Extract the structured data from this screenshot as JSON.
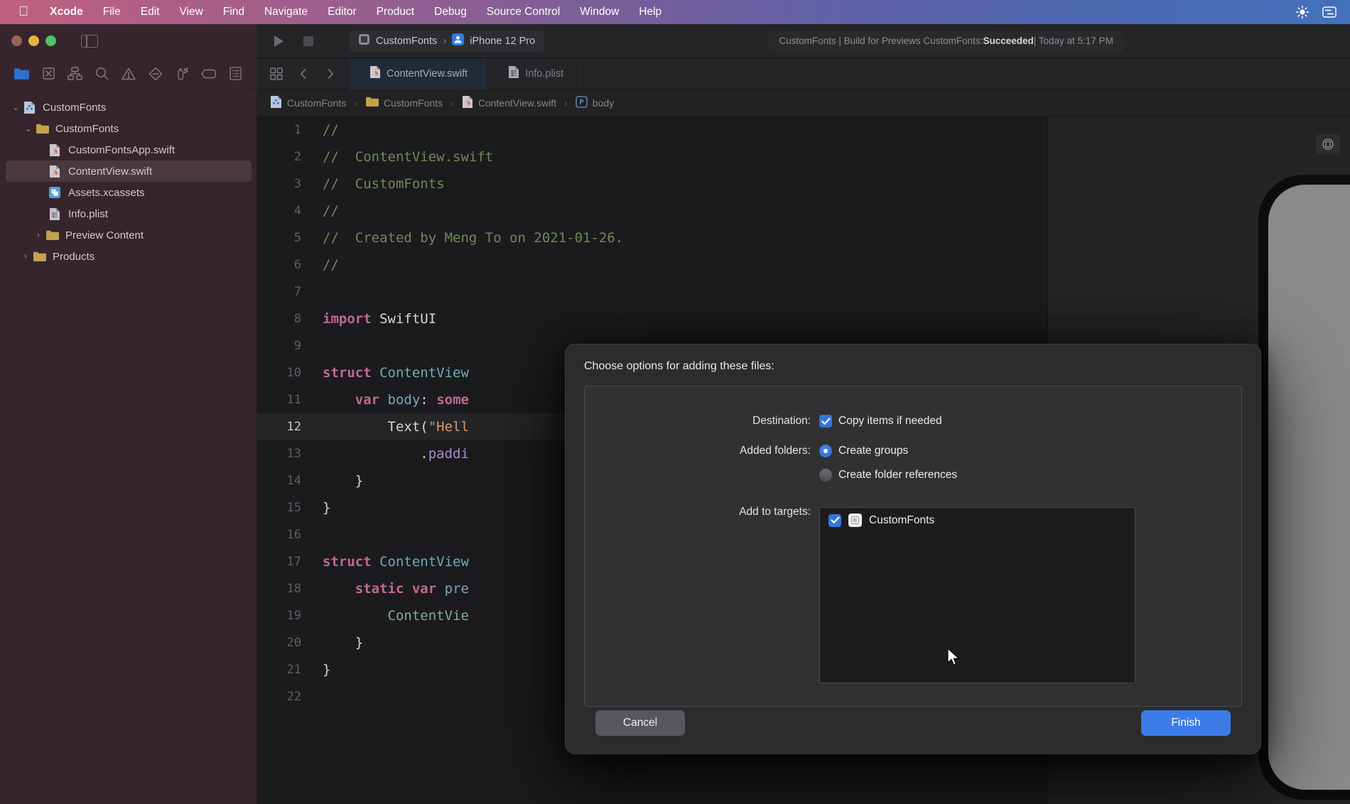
{
  "menubar": {
    "apple_icon": "apple-logo-icon",
    "items": [
      {
        "label": "Xcode",
        "bold": true
      },
      {
        "label": "File",
        "bold": false
      },
      {
        "label": "Edit",
        "bold": false
      },
      {
        "label": "View",
        "bold": false
      },
      {
        "label": "Find",
        "bold": false
      },
      {
        "label": "Navigate",
        "bold": false
      },
      {
        "label": "Editor",
        "bold": false
      },
      {
        "label": "Product",
        "bold": false
      },
      {
        "label": "Debug",
        "bold": false
      },
      {
        "label": "Source Control",
        "bold": false
      },
      {
        "label": "Window",
        "bold": false
      },
      {
        "label": "Help",
        "bold": false
      }
    ],
    "status_icons": [
      "brightness-icon",
      "control-center-icon"
    ]
  },
  "titlebar": {
    "traffic_lights": [
      "close-button",
      "minimize-button",
      "zoom-button"
    ],
    "sidebar_toggle_icon": "sidebar-toggle-icon",
    "run_icon": "run-icon",
    "stop_icon": "stop-icon",
    "scheme": {
      "project": "CustomFonts",
      "separator": "›",
      "device": "iPhone 12 Pro"
    },
    "status": {
      "prefix": "CustomFonts | Build for Previews CustomFonts: ",
      "result": "Succeeded",
      "suffix": " | Today at 5:17 PM"
    }
  },
  "navigator_toolbar": {
    "icons": [
      "project-navigator-icon",
      "source-control-navigator-icon",
      "symbol-navigator-icon",
      "find-navigator-icon",
      "issue-navigator-icon",
      "test-navigator-icon",
      "debug-navigator-icon",
      "breakpoint-navigator-icon",
      "report-navigator-icon"
    ]
  },
  "editor_tabs": {
    "grid_icon": "tab-grid-icon",
    "back_icon": "chevron-left-icon",
    "forward_icon": "chevron-right-icon",
    "tabs": [
      {
        "label": "ContentView.swift",
        "icon": "swift-file-icon",
        "active": true
      },
      {
        "label": "Info.plist",
        "icon": "plist-file-icon",
        "active": false
      }
    ]
  },
  "breadcrumb": {
    "separator": "›",
    "items": [
      {
        "label": "CustomFonts",
        "icon": "xcode-project-icon"
      },
      {
        "label": "CustomFonts",
        "icon": "folder-icon"
      },
      {
        "label": "ContentView.swift",
        "icon": "swift-file-icon"
      },
      {
        "label": "body",
        "icon": "property-icon"
      }
    ]
  },
  "navigator": {
    "items": [
      {
        "label": "CustomFonts",
        "icon": "xcode-project-icon",
        "indent": 0,
        "twisty": "⌄",
        "selected": false
      },
      {
        "label": "CustomFonts",
        "icon": "folder-icon",
        "indent": 1,
        "twisty": "⌄",
        "selected": false
      },
      {
        "label": "CustomFontsApp.swift",
        "icon": "swift-file-icon",
        "indent": 2,
        "twisty": "",
        "selected": false
      },
      {
        "label": "ContentView.swift",
        "icon": "swift-file-icon",
        "indent": 2,
        "twisty": "",
        "selected": true
      },
      {
        "label": "Assets.xcassets",
        "icon": "assets-icon",
        "indent": 2,
        "twisty": "",
        "selected": false
      },
      {
        "label": "Info.plist",
        "icon": "plist-file-icon",
        "indent": 2,
        "twisty": "",
        "selected": false
      },
      {
        "label": "Preview Content",
        "icon": "folder-icon",
        "indent": 2,
        "twisty": "›",
        "selected": false
      },
      {
        "label": "Products",
        "icon": "folder-icon",
        "indent": 1,
        "twisty": "›",
        "selected": false
      }
    ]
  },
  "editor": {
    "lines": [
      {
        "n": "1",
        "hl": false,
        "tokens": [
          {
            "t": "//",
            "c": "cmt"
          }
        ]
      },
      {
        "n": "2",
        "hl": false,
        "tokens": [
          {
            "t": "//  ContentView.swift",
            "c": "cmt"
          }
        ]
      },
      {
        "n": "3",
        "hl": false,
        "tokens": [
          {
            "t": "//  CustomFonts",
            "c": "cmt"
          }
        ]
      },
      {
        "n": "4",
        "hl": false,
        "tokens": [
          {
            "t": "//",
            "c": "cmt"
          }
        ]
      },
      {
        "n": "5",
        "hl": false,
        "tokens": [
          {
            "t": "//  Created by Meng To on 2021-01-26.",
            "c": "cmt"
          }
        ]
      },
      {
        "n": "6",
        "hl": false,
        "tokens": [
          {
            "t": "//",
            "c": "cmt"
          }
        ]
      },
      {
        "n": "7",
        "hl": false,
        "tokens": [
          {
            "t": "",
            "c": "pln"
          }
        ]
      },
      {
        "n": "8",
        "hl": false,
        "tokens": [
          {
            "t": "import",
            "c": "kw"
          },
          {
            "t": " SwiftUI",
            "c": "pln"
          }
        ]
      },
      {
        "n": "9",
        "hl": false,
        "tokens": [
          {
            "t": "",
            "c": "pln"
          }
        ]
      },
      {
        "n": "10",
        "hl": false,
        "tokens": [
          {
            "t": "struct",
            "c": "kw"
          },
          {
            "t": " ContentView",
            "c": "typ"
          }
        ]
      },
      {
        "n": "11",
        "hl": false,
        "tokens": [
          {
            "t": "    ",
            "c": "pln"
          },
          {
            "t": "var",
            "c": "kw"
          },
          {
            "t": " body",
            "c": "typ"
          },
          {
            "t": ": ",
            "c": "pln"
          },
          {
            "t": "some",
            "c": "kw"
          }
        ]
      },
      {
        "n": "12",
        "hl": true,
        "tokens": [
          {
            "t": "        Text(",
            "c": "pln"
          },
          {
            "t": "\"Hell",
            "c": "str"
          }
        ]
      },
      {
        "n": "13",
        "hl": false,
        "tokens": [
          {
            "t": "            .",
            "c": "pln"
          },
          {
            "t": "paddi",
            "c": "fn"
          }
        ]
      },
      {
        "n": "14",
        "hl": false,
        "tokens": [
          {
            "t": "    }",
            "c": "pln"
          }
        ]
      },
      {
        "n": "15",
        "hl": false,
        "tokens": [
          {
            "t": "}",
            "c": "pln"
          }
        ]
      },
      {
        "n": "16",
        "hl": false,
        "tokens": [
          {
            "t": "",
            "c": "pln"
          }
        ]
      },
      {
        "n": "17",
        "hl": false,
        "tokens": [
          {
            "t": "struct",
            "c": "kw"
          },
          {
            "t": " ContentView",
            "c": "typ"
          }
        ]
      },
      {
        "n": "18",
        "hl": false,
        "tokens": [
          {
            "t": "    ",
            "c": "pln"
          },
          {
            "t": "static",
            "c": "kw"
          },
          {
            "t": " ",
            "c": "pln"
          },
          {
            "t": "var",
            "c": "kw"
          },
          {
            "t": " pre",
            "c": "typ"
          }
        ]
      },
      {
        "n": "19",
        "hl": false,
        "tokens": [
          {
            "t": "        ContentVie",
            "c": "grn"
          }
        ]
      },
      {
        "n": "20",
        "hl": false,
        "tokens": [
          {
            "t": "    }",
            "c": "pln"
          }
        ]
      },
      {
        "n": "21",
        "hl": false,
        "tokens": [
          {
            "t": "}",
            "c": "pln"
          }
        ]
      },
      {
        "n": "22",
        "hl": false,
        "tokens": [
          {
            "t": "",
            "c": "pln"
          }
        ]
      }
    ]
  },
  "canvas": {
    "control_icon": "preview-device-settings-icon",
    "device": "iPhone 12 Pro"
  },
  "dialog": {
    "title": "Choose options for adding these files:",
    "destination": {
      "label": "Destination:",
      "checkbox_label": "Copy items if needed",
      "checked": true
    },
    "added_folders": {
      "label": "Added folders:",
      "options": [
        {
          "label": "Create groups",
          "selected": true
        },
        {
          "label": "Create folder references",
          "selected": false
        }
      ]
    },
    "add_to_targets": {
      "label": "Add to targets:",
      "rows": [
        {
          "name": "CustomFonts",
          "checked": true,
          "icon": "app-target-icon"
        }
      ]
    },
    "cancel_label": "Cancel",
    "finish_label": "Finish"
  },
  "colors": {
    "accent_blue": "#3574e0",
    "finish_blue": "#3c7ce8",
    "sidebar_bg": "#36252c",
    "editor_bg": "#1b1b1d",
    "dialog_bg": "#2c2c2e"
  }
}
